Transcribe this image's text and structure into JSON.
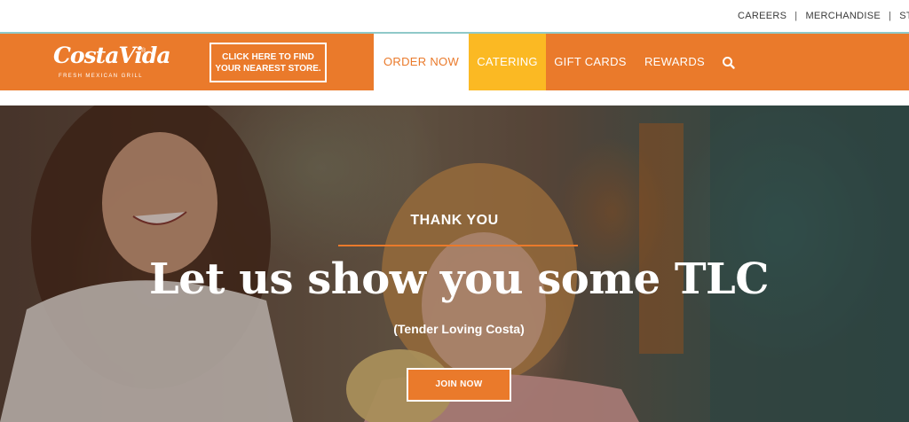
{
  "utility_nav": {
    "links": [
      "CAREERS",
      "MERCHANDISE",
      "STORE"
    ],
    "separator": "|"
  },
  "brand": {
    "name": "CostaVida",
    "trademark": "®",
    "tagline": "FRESH MEXICAN GRILL"
  },
  "find_store": {
    "line1": "CLICK HERE TO FIND",
    "line2": "YOUR NEAREST STORE."
  },
  "main_nav": {
    "items": [
      {
        "label": "ORDER NOW",
        "state": "active"
      },
      {
        "label": "CATERING",
        "state": "highlighted"
      },
      {
        "label": "GIFT CARDS"
      },
      {
        "label": "REWARDS"
      }
    ],
    "search_icon": "search-icon"
  },
  "hero": {
    "eyebrow": "THANK YOU",
    "title": "Let us show you some TLC",
    "subtitle": "(Tender Loving Costa)",
    "cta": "JOIN NOW"
  },
  "colors": {
    "brand_orange": "#ea7a2b",
    "catering_yellow": "#fbb923",
    "accent_teal": "#8fc9c9",
    "white": "#ffffff"
  }
}
